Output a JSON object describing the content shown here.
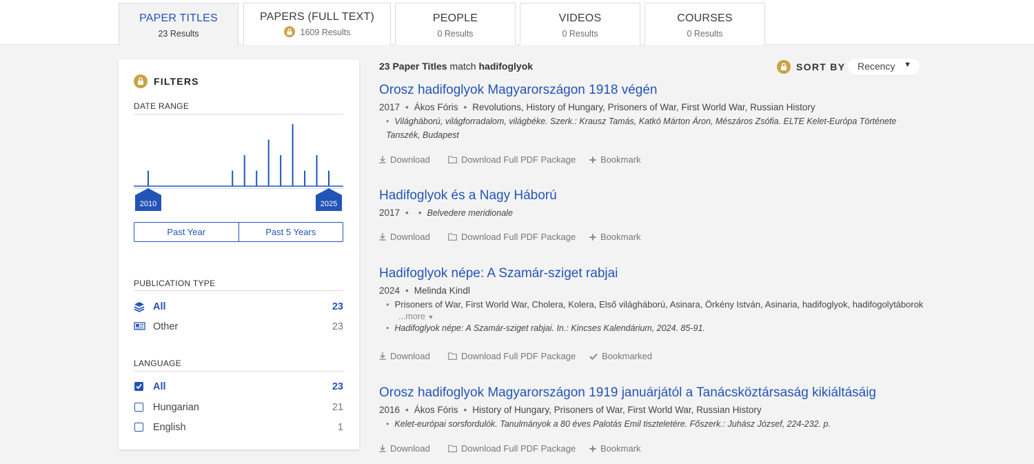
{
  "tabs": [
    {
      "title": "PAPER TITLES",
      "count": "23 Results",
      "active": true
    },
    {
      "title": "PAPERS (FULL TEXT)",
      "count": "1609 Results",
      "locked": true
    },
    {
      "title": "PEOPLE",
      "count": "0 Results"
    },
    {
      "title": "VIDEOS",
      "count": "0 Results"
    },
    {
      "title": "COURSES",
      "count": "0 Results"
    }
  ],
  "filters": {
    "heading": "FILTERS",
    "date_range": {
      "title": "DATE RANGE",
      "start_label": "2010",
      "end_label": "2025",
      "past_year": "Past Year",
      "past_5_years": "Past 5 Years"
    },
    "publication_type": {
      "title": "PUBLICATION TYPE",
      "items": [
        {
          "label": "All",
          "count": "23",
          "selected": true
        },
        {
          "label": "Other",
          "count": "23"
        }
      ]
    },
    "language": {
      "title": "LANGUAGE",
      "items": [
        {
          "label": "All",
          "count": "23",
          "checked": true
        },
        {
          "label": "Hungarian",
          "count": "21"
        },
        {
          "label": "English",
          "count": "1"
        }
      ]
    }
  },
  "chart_data": {
    "type": "bar",
    "x": [
      2010,
      2017,
      2018,
      2019,
      2020,
      2021,
      2022,
      2023,
      2024,
      2025
    ],
    "values": [
      1,
      1,
      2,
      1,
      3,
      2,
      4,
      1,
      2,
      1
    ],
    "xlim": [
      2010,
      2025
    ],
    "color": "#2254b8"
  },
  "results_header": {
    "count_label": "23 Paper Titles",
    "match_word": "match",
    "query": "hadifoglyok",
    "sort_label": "SORT BY",
    "sort_value": "Recency"
  },
  "results": [
    {
      "title": "Orosz hadifoglyok Magyarországon 1918 végén",
      "year": "2017",
      "author": "Ákos Fóris",
      "tags": "Revolutions, History of Hungary, Prisoners of War, First World War, Russian History",
      "note": "Világháború, világforradalom, világbéke. Szerk.: Krausz Tamás, Katkó Márton Áron, Mészáros Zsófia. ELTE Kelet-Európa Története Tanszék, Budapest",
      "download": "Download",
      "package": "Download Full PDF Package",
      "bookmark": "Bookmark"
    },
    {
      "title": "Hadifoglyok és a Nagy Háború",
      "year": "2017",
      "note": "Belvedere meridionale",
      "download": "Download",
      "package": "Download Full PDF Package",
      "bookmark": "Bookmark"
    },
    {
      "title": "Hadifoglyok népe: A Szamár-sziget rabjai",
      "year": "2024",
      "author": "Melinda Kindl",
      "tags": "Prisoners of War, First World War, Cholera, Kolera, Első világháború, Asinara, Örkény István, Asinaria, hadifoglyok, hadifogolytáborok",
      "more": "...more",
      "note": "Hadifoglyok népe: A Szamár-sziget rabjai. In.: Kincses Kalendárium, 2024. 85-91.",
      "download": "Download",
      "package": "Download Full PDF Package",
      "bookmark": "Bookmarked"
    },
    {
      "title": "Orosz hadifoglyok Magyarországon 1919 januárjától a Tanácsköztársaság kikiáltásáig",
      "year": "2016",
      "author": "Ákos Fóris",
      "tags": "History of Hungary, Prisoners of War, First World War, Russian History",
      "note": "Kelet-európai sorsfordulók. Tanulmányok a 80 éves Palotás Emil tiszteletére. Főszerk.: Juhász József, 224-232. p.",
      "download": "Download",
      "package": "Download Full PDF Package",
      "bookmark": "Bookmark"
    }
  ]
}
